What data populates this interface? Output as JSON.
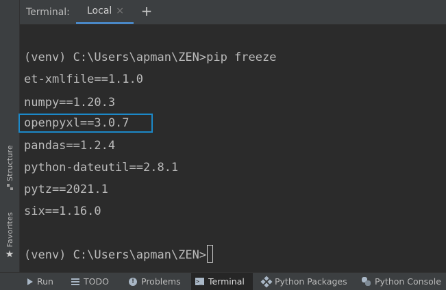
{
  "header": {
    "title": "Terminal:",
    "active_tab_label": "Local",
    "close_glyph": "×",
    "new_tab_glyph": "+"
  },
  "left_strip": {
    "items": [
      {
        "label": "Structure",
        "icon": "structure-icon"
      },
      {
        "label": "Favorites",
        "icon": "star-icon"
      }
    ]
  },
  "terminal": {
    "lines": [
      "(venv) C:\\Users\\apman\\ZEN>pip freeze",
      "et-xmlfile==1.1.0",
      "numpy==1.20.3",
      "openpyxl==3.0.7",
      "pandas==1.2.4",
      "python-dateutil==2.8.1",
      "pytz==2021.1",
      "six==1.16.0"
    ],
    "prompt": "(venv) C:\\Users\\apman\\ZEN>",
    "highlighted_line_index": 3,
    "highlight_color": "#1c89c9"
  },
  "bottom_bar": {
    "tabs": [
      {
        "label": "Run",
        "icon": "run-icon",
        "active": false
      },
      {
        "label": "TODO",
        "icon": "todo-icon",
        "active": false
      },
      {
        "label": "Problems",
        "icon": "problems-icon",
        "active": false
      },
      {
        "label": "Terminal",
        "icon": "terminal-icon",
        "active": true
      },
      {
        "label": "Python Packages",
        "icon": "python-packages-icon",
        "active": false
      },
      {
        "label": "Python Console",
        "icon": "python-console-icon",
        "active": false
      }
    ]
  },
  "colors": {
    "background": "#2b2b2b",
    "panel": "#3c3f41",
    "accent": "#4a88c7",
    "text": "#bbbbbb"
  }
}
